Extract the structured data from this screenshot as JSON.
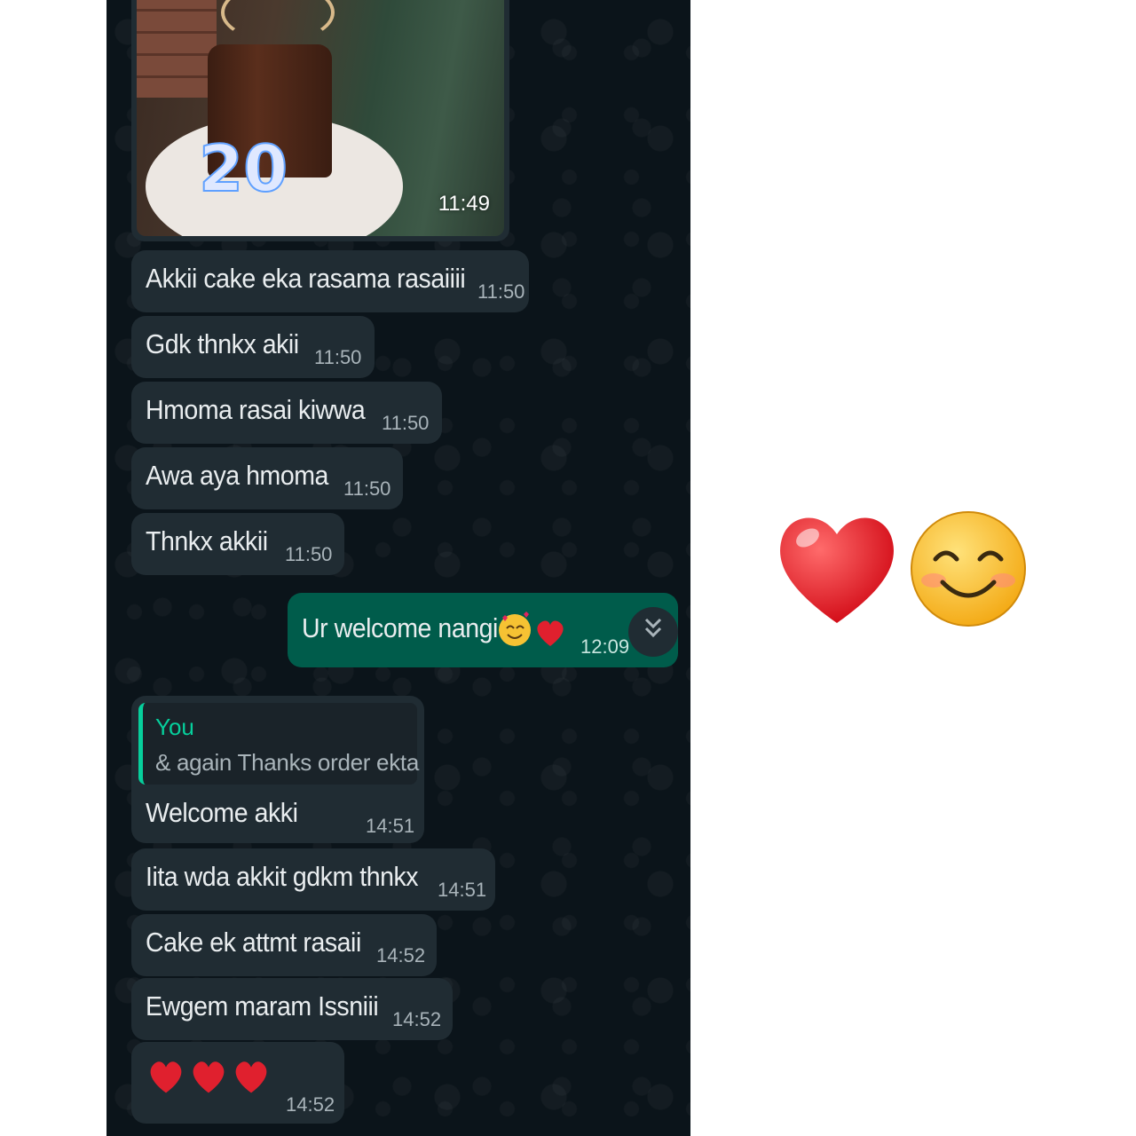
{
  "photo_message": {
    "time": "11:49",
    "candle_number": "20"
  },
  "messages": [
    {
      "text": "Akkii cake eka rasama rasaiiii",
      "time": "11:50"
    },
    {
      "text": "Gdk thnkx akii",
      "time": "11:50"
    },
    {
      "text": "Hmoma rasai kiwwa",
      "time": "11:50"
    },
    {
      "text": "Awa aya hmoma",
      "time": "11:50"
    },
    {
      "text": "Thnkx akkii",
      "time": "11:50"
    }
  ],
  "outgoing": {
    "text": "Ur welcome nangi",
    "time": "12:09",
    "emoji": "smiling-face-with-hearts + red-heart"
  },
  "reply": {
    "quote_author": "You",
    "quote_text": "& again Thanks order ekta",
    "text": "Welcome akki",
    "time": "14:51"
  },
  "later_messages": [
    {
      "text": "Iita wda akkit gdkm thnkx",
      "time": "14:51"
    },
    {
      "text": "Cake ek attmt rasaii",
      "time": "14:52"
    },
    {
      "text": "Ewgem maram Issniii",
      "time": "14:52"
    }
  ],
  "hearts_message": {
    "time": "14:52",
    "count": 3
  },
  "side_emojis": [
    "red-heart",
    "smiling-face-with-smiling-eyes"
  ],
  "colors": {
    "chat_bg": "#0b141a",
    "incoming": "#202c33",
    "outgoing": "#005c4b",
    "accent": "#06cf9c"
  }
}
